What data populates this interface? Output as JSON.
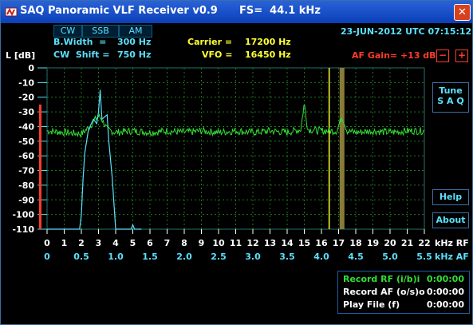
{
  "window": {
    "title": "SAQ Panoramic VLF Receiver v0.9      FS=  44.1 kHz",
    "close_symbol": "✕"
  },
  "modes": [
    "CW",
    "SSB",
    "AM"
  ],
  "info": {
    "bwidth_label": "B.Width  =",
    "bwidth_value": "300 Hz",
    "cwshift_label": "CW  Shift =",
    "cwshift_value": "750 Hz",
    "carrier_label": "Carrier =",
    "carrier_value": "17200 Hz",
    "vfo_label": "VFO =",
    "vfo_value": "16450 Hz",
    "datetime": "23-JUN-2012 UTC 07:15:12",
    "af_gain": "AF Gain= +13 dB",
    "minus": "−",
    "plus": "+"
  },
  "buttons": {
    "tune_line1": "Tune",
    "tune_line2": "S A Q",
    "help": "Help",
    "about": "About"
  },
  "status": {
    "record_rf": "Record  RF (i/b)i",
    "record_rf_time": "0:00:00",
    "record_af": "Record  AF (o/s)o",
    "record_af_time": "0:00:00",
    "play_file": "Play File (f)",
    "play_file_time": "0:00:00"
  },
  "colors": {
    "background": "#000000",
    "cyan": "#5ae0ff",
    "yellow": "#ffff33",
    "green": "#33dd33",
    "red": "#ff3a2a",
    "grid": "#1e7a1e"
  },
  "chart_data": {
    "type": "line",
    "ylabel": "L [dB]",
    "ylim": [
      -110,
      0
    ],
    "yticks": [
      "0",
      "-10",
      "-20",
      "-30",
      "-40",
      "-50",
      "-60",
      "-70",
      "-80",
      "-90",
      "-100",
      "-110"
    ],
    "rf_axis": {
      "label": "kHz RF",
      "range": [
        0,
        22
      ],
      "ticks": [
        "0",
        "1",
        "2",
        "3",
        "4",
        "5",
        "6",
        "7",
        "8",
        "9",
        "10",
        "11",
        "12",
        "13",
        "14",
        "15",
        "16",
        "17",
        "18",
        "19",
        "20",
        "21",
        "22"
      ]
    },
    "af_axis": {
      "label": "kHz AF",
      "range": [
        0,
        5.5
      ],
      "ticks": [
        "0",
        "0.5",
        "1.0",
        "1.5",
        "2.0",
        "2.5",
        "3.0",
        "3.5",
        "4.0",
        "4.5",
        "5.0",
        "5.5"
      ]
    },
    "series": [
      {
        "color": "#33dd33",
        "noise_floor": -43,
        "points": [
          [
            0,
            -43
          ],
          [
            1,
            -44
          ],
          [
            2,
            -45
          ],
          [
            2.5,
            -40
          ],
          [
            2.8,
            -35
          ],
          [
            3,
            -33
          ],
          [
            3.2,
            -35
          ],
          [
            3.5,
            -42
          ],
          [
            4,
            -44
          ],
          [
            5,
            -43
          ],
          [
            6,
            -44
          ],
          [
            7,
            -43
          ],
          [
            8,
            -44
          ],
          [
            9,
            -43
          ],
          [
            10,
            -44
          ],
          [
            11,
            -43
          ],
          [
            12,
            -44
          ],
          [
            13,
            -43
          ],
          [
            14,
            -44
          ],
          [
            14.8,
            -42
          ],
          [
            15,
            -24
          ],
          [
            15.2,
            -42
          ],
          [
            16,
            -43
          ],
          [
            16.9,
            -43
          ],
          [
            17.2,
            -33
          ],
          [
            17.5,
            -43
          ],
          [
            18,
            -44
          ],
          [
            19,
            -43
          ],
          [
            20,
            -44
          ],
          [
            21,
            -43
          ],
          [
            22,
            -43
          ]
        ]
      },
      {
        "color": "#5ae0ff",
        "points": [
          [
            0,
            -110
          ],
          [
            1.9,
            -110
          ],
          [
            2,
            -100
          ],
          [
            2.1,
            -75
          ],
          [
            2.2,
            -58
          ],
          [
            2.4,
            -43
          ],
          [
            2.5,
            -40
          ],
          [
            2.7,
            -35
          ],
          [
            2.9,
            -38
          ],
          [
            3.0,
            -30
          ],
          [
            3.1,
            -15
          ],
          [
            3.2,
            -35
          ],
          [
            3.3,
            -34
          ],
          [
            3.5,
            -32
          ],
          [
            3.6,
            -50
          ],
          [
            3.8,
            -75
          ],
          [
            4.0,
            -110
          ],
          [
            4.9,
            -110
          ],
          [
            5.0,
            -107
          ],
          [
            5.1,
            -110
          ],
          [
            5.5,
            -110
          ]
        ]
      }
    ],
    "markers": [
      {
        "type": "carrier",
        "khz": 16.45,
        "color": "#ffff33"
      },
      {
        "type": "passband",
        "khz": 17.2,
        "color": "#8a7a3a"
      }
    ],
    "level_bar": {
      "color": "#ff3a2a",
      "from_db": -110,
      "to_db": -25
    }
  }
}
